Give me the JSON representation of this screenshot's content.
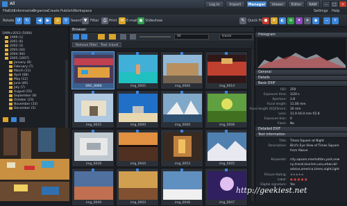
{
  "app": {
    "title": "All"
  },
  "modes": [
    "Log In",
    "Import",
    "Manager",
    "Viewer",
    "Editor",
    "RAW"
  ],
  "menu": [
    "File",
    "Edit",
    "Information",
    "Organize",
    "Create",
    "Publish",
    "Workspace"
  ],
  "menu_right": [
    "Settings",
    "Help"
  ],
  "toolbar": {
    "rotate": "Rotate",
    "search": "Search",
    "filter": "Filter",
    "print": "Print",
    "email": "E-mail",
    "slideshow": "Slideshow",
    "quickfix": "Quick Fix"
  },
  "tree": [
    "1999>2013 (5000)",
    "1999 (1)",
    "2001 (6)",
    "2002 (3)",
    "2003 (44)",
    "2004 (66)",
    "2005 (1007)",
    "January (8)",
    "February (7)",
    "March (11)",
    "April (68)",
    "May (12)",
    "June (85)",
    "July (7)",
    "August (55)",
    "September (8)",
    "October (23)",
    "November (33)",
    "December (5)"
  ],
  "browser": {
    "title": "Browser",
    "view": "All",
    "search": "travel"
  },
  "filters": [
    "Remove Filter",
    "Text: travel"
  ],
  "thumbs": [
    "DSC_0060",
    "img_0005",
    "img_0000",
    "img_0014",
    "img_0025",
    "img_0000",
    "img_0000",
    "img_0008",
    "img_0028",
    "img_0044",
    "img_0053",
    "img_0005",
    "img_0049",
    "img_0003",
    "img_0046",
    "img_0047"
  ],
  "panels": {
    "histogram": "Histogram",
    "general": "General",
    "details": "Details",
    "basic_exif": "Basic EXIF",
    "detailed_exif": "Detailed EXIF",
    "text_info": "Text information"
  },
  "exif": [
    {
      "k": "ISO:",
      "v": "250"
    },
    {
      "k": "Exposure time:",
      "v": "1/20 s"
    },
    {
      "k": "Aperture:",
      "v": "2.8"
    },
    {
      "k": "Focal length:",
      "v": "11.00 mm"
    },
    {
      "k": "Focal length (EQ35mm):",
      "v": "16 mm"
    },
    {
      "k": "Lens:",
      "v": "11.0-16.0 mm f/2.8"
    },
    {
      "k": "Exposure bias:",
      "v": "0"
    },
    {
      "k": "Flash:",
      "v": "No"
    }
  ],
  "textinfo": [
    {
      "k": "Title:",
      "v": "Times Square at Night"
    },
    {
      "k": "Description:",
      "v": "Bird's Eye View of Times Square"
    },
    {
      "k": "",
      "v": "from Above"
    },
    {
      "k": "Keywords:",
      "v": "city,square,manhattan,york,new"
    },
    {
      "k": "",
      "v": "ny,travel,tourism,usa,urban,bil"
    },
    {
      "k": "",
      "v": "advise,america,times,night,light"
    },
    {
      "k": "Picture Rating:",
      "v": "★★★★★"
    },
    {
      "k": "Label:",
      "v": "● ● ● ● ●"
    },
    {
      "k": "Digital signature:",
      "v": "Yes"
    }
  ],
  "watermark": "http://geekiest.net",
  "colors": {
    "accent": "#3c86d8",
    "bg": "#1a1d22"
  }
}
